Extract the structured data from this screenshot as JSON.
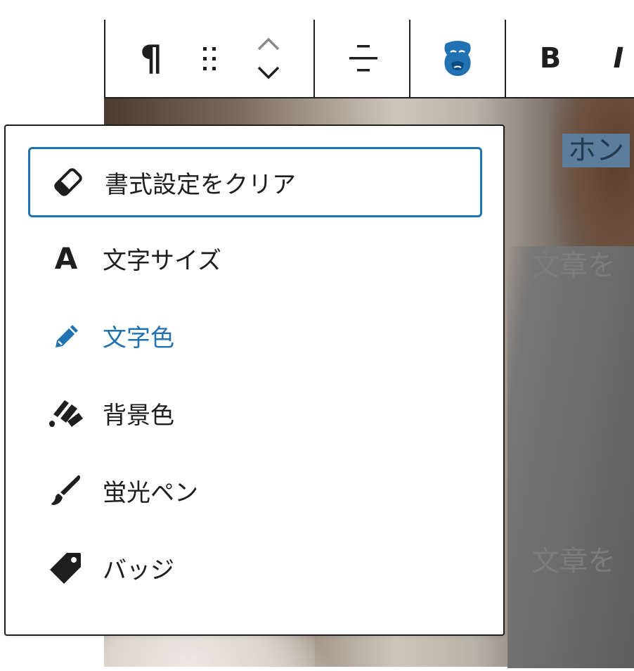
{
  "toolbar": {
    "paragraph_icon": "¶",
    "bold_label": "B",
    "italic_label": "I"
  },
  "background_text": {
    "highlighted": "ホン",
    "line1": "文章を",
    "line2": "文章を"
  },
  "menu": {
    "items": [
      {
        "label": "書式設定をクリア",
        "icon": "eraser-icon"
      },
      {
        "label": "文字サイズ",
        "icon": "font-size-icon",
        "glyph": "A"
      },
      {
        "label": "文字色",
        "icon": "pencil-icon"
      },
      {
        "label": "背景色",
        "icon": "paint-roller-icon"
      },
      {
        "label": "蛍光ペン",
        "icon": "brush-icon"
      },
      {
        "label": "バッジ",
        "icon": "tag-icon"
      }
    ]
  },
  "colors": {
    "accent": "#2271b1",
    "text": "#1e1e1e"
  }
}
